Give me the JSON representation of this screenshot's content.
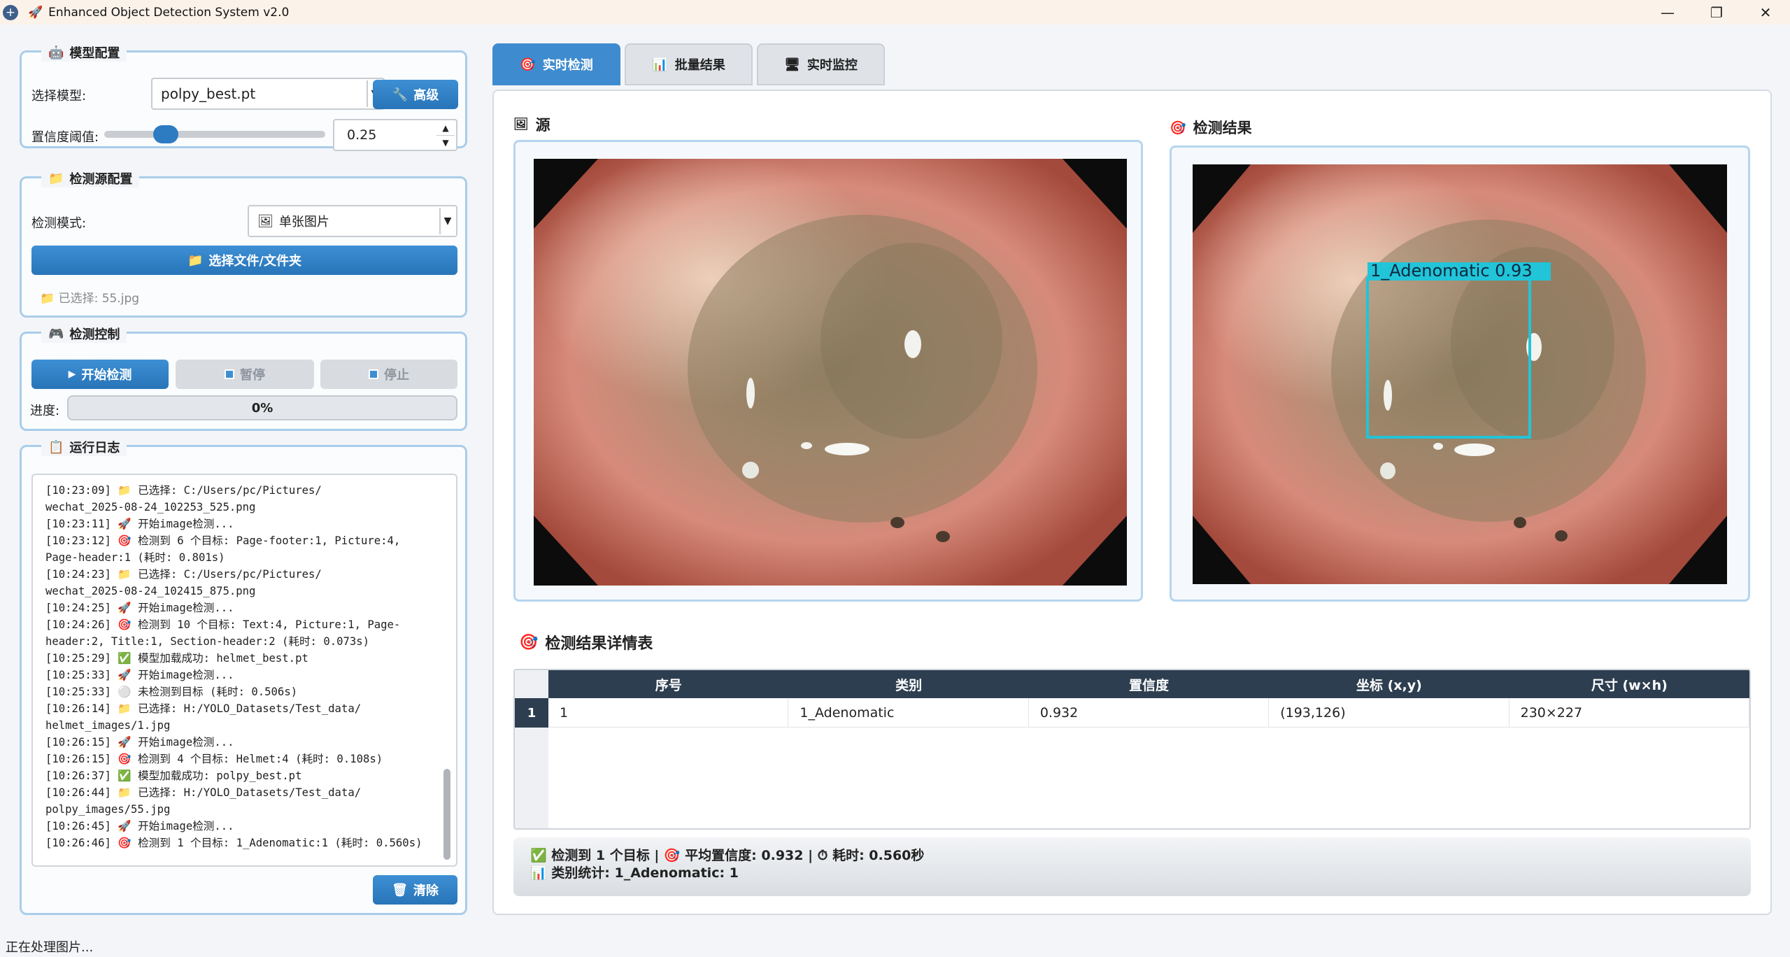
{
  "window": {
    "title": "Enhanced Object Detection System v2.0",
    "title_emoji": "🚀",
    "controls": [
      "—",
      "❐",
      "✕"
    ]
  },
  "model_config": {
    "title": "模型配置",
    "icon": "🤖",
    "select_label": "选择模型:",
    "model_value": "polpy_best.pt",
    "advanced_button": "高级",
    "advanced_icon": "🔧",
    "confidence_label": "置信度阈值:",
    "confidence_value": "0.25",
    "confidence_fraction": 0.25
  },
  "source_config": {
    "title": "检测源配置",
    "icon": "📁",
    "mode_label": "检测模式:",
    "mode_icon": "🖼",
    "mode_value": "单张图片",
    "select_button": "选择文件/文件夹",
    "selected_text": "已选择: 55.jpg"
  },
  "detect_control": {
    "title": "检测控制",
    "icon": "🎮",
    "start_button": "开始检测",
    "pause_button": "暂停",
    "stop_button": "停止",
    "progress_label": "进度:",
    "progress_text": "0%",
    "progress_value": 0
  },
  "log": {
    "title": "运行日志",
    "icon": "📋",
    "clear_button": "清除",
    "clear_icon": "🗑",
    "lines": [
      "[10:23:09] 📁 已选择: C:/Users/pc/Pictures/",
      "wechat_2025-08-24_102253_525.png",
      "[10:23:11] 🚀 开始image检测...",
      "[10:23:12] 🎯 检测到 6 个目标: Page-footer:1, Picture:4,",
      "Page-header:1 (耗时: 0.801s)",
      "[10:24:23] 📁 已选择: C:/Users/pc/Pictures/",
      "wechat_2025-08-24_102415_875.png",
      "[10:24:25] 🚀 开始image检测...",
      "[10:24:26] 🎯 检测到 10 个目标: Text:4, Picture:1, Page-",
      "header:2, Title:1, Section-header:2 (耗时: 0.073s)",
      "[10:25:29] ✅ 模型加载成功: helmet_best.pt",
      "[10:25:33] 🚀 开始image检测...",
      "[10:25:33] ⚪ 未检测到目标 (耗时: 0.506s)",
      "[10:26:14] 📁 已选择: H:/YOLO_Datasets/Test_data/",
      "helmet_images/1.jpg",
      "[10:26:15] 🚀 开始image检测...",
      "[10:26:15] 🎯 检测到 4 个目标: Helmet:4 (耗时: 0.108s)",
      "[10:26:37] ✅ 模型加载成功: polpy_best.pt",
      "[10:26:44] 📁 已选择: H:/YOLO_Datasets/Test_data/",
      "polpy_images/55.jpg",
      "[10:26:45] 🚀 开始image检测...",
      "[10:26:46] 🎯 检测到 1 个目标: 1_Adenomatic:1 (耗时: 0.560s)"
    ]
  },
  "tabs": [
    {
      "label": "实时检测",
      "icon": "🎯",
      "active": true
    },
    {
      "label": "批量结果",
      "icon": "📊",
      "active": false
    },
    {
      "label": "实时监控",
      "icon": "🖥",
      "active": false
    }
  ],
  "views": {
    "source_title": "源",
    "source_icon": "🖼",
    "result_title": "检测结果",
    "result_icon": "🎯",
    "detection_label": "1_Adenomatic  0.93"
  },
  "details": {
    "title": "检测结果详情表",
    "icon": "🎯",
    "columns": [
      "序号",
      "类别",
      "置信度",
      "坐标 (x,y)",
      "尺寸 (w×h)"
    ],
    "rows": [
      {
        "index": "1",
        "cells": [
          "1",
          "1_Adenomatic",
          "0.932",
          "(193,126)",
          "230×227"
        ]
      }
    ]
  },
  "summary": {
    "line1": "✅ 检测到 1 个目标 | 🎯 平均置信度: 0.932 | ⏱ 耗时: 0.560秒",
    "line2": "📊 类别统计: 1_Adenomatic: 1"
  },
  "status": "正在处理图片..."
}
